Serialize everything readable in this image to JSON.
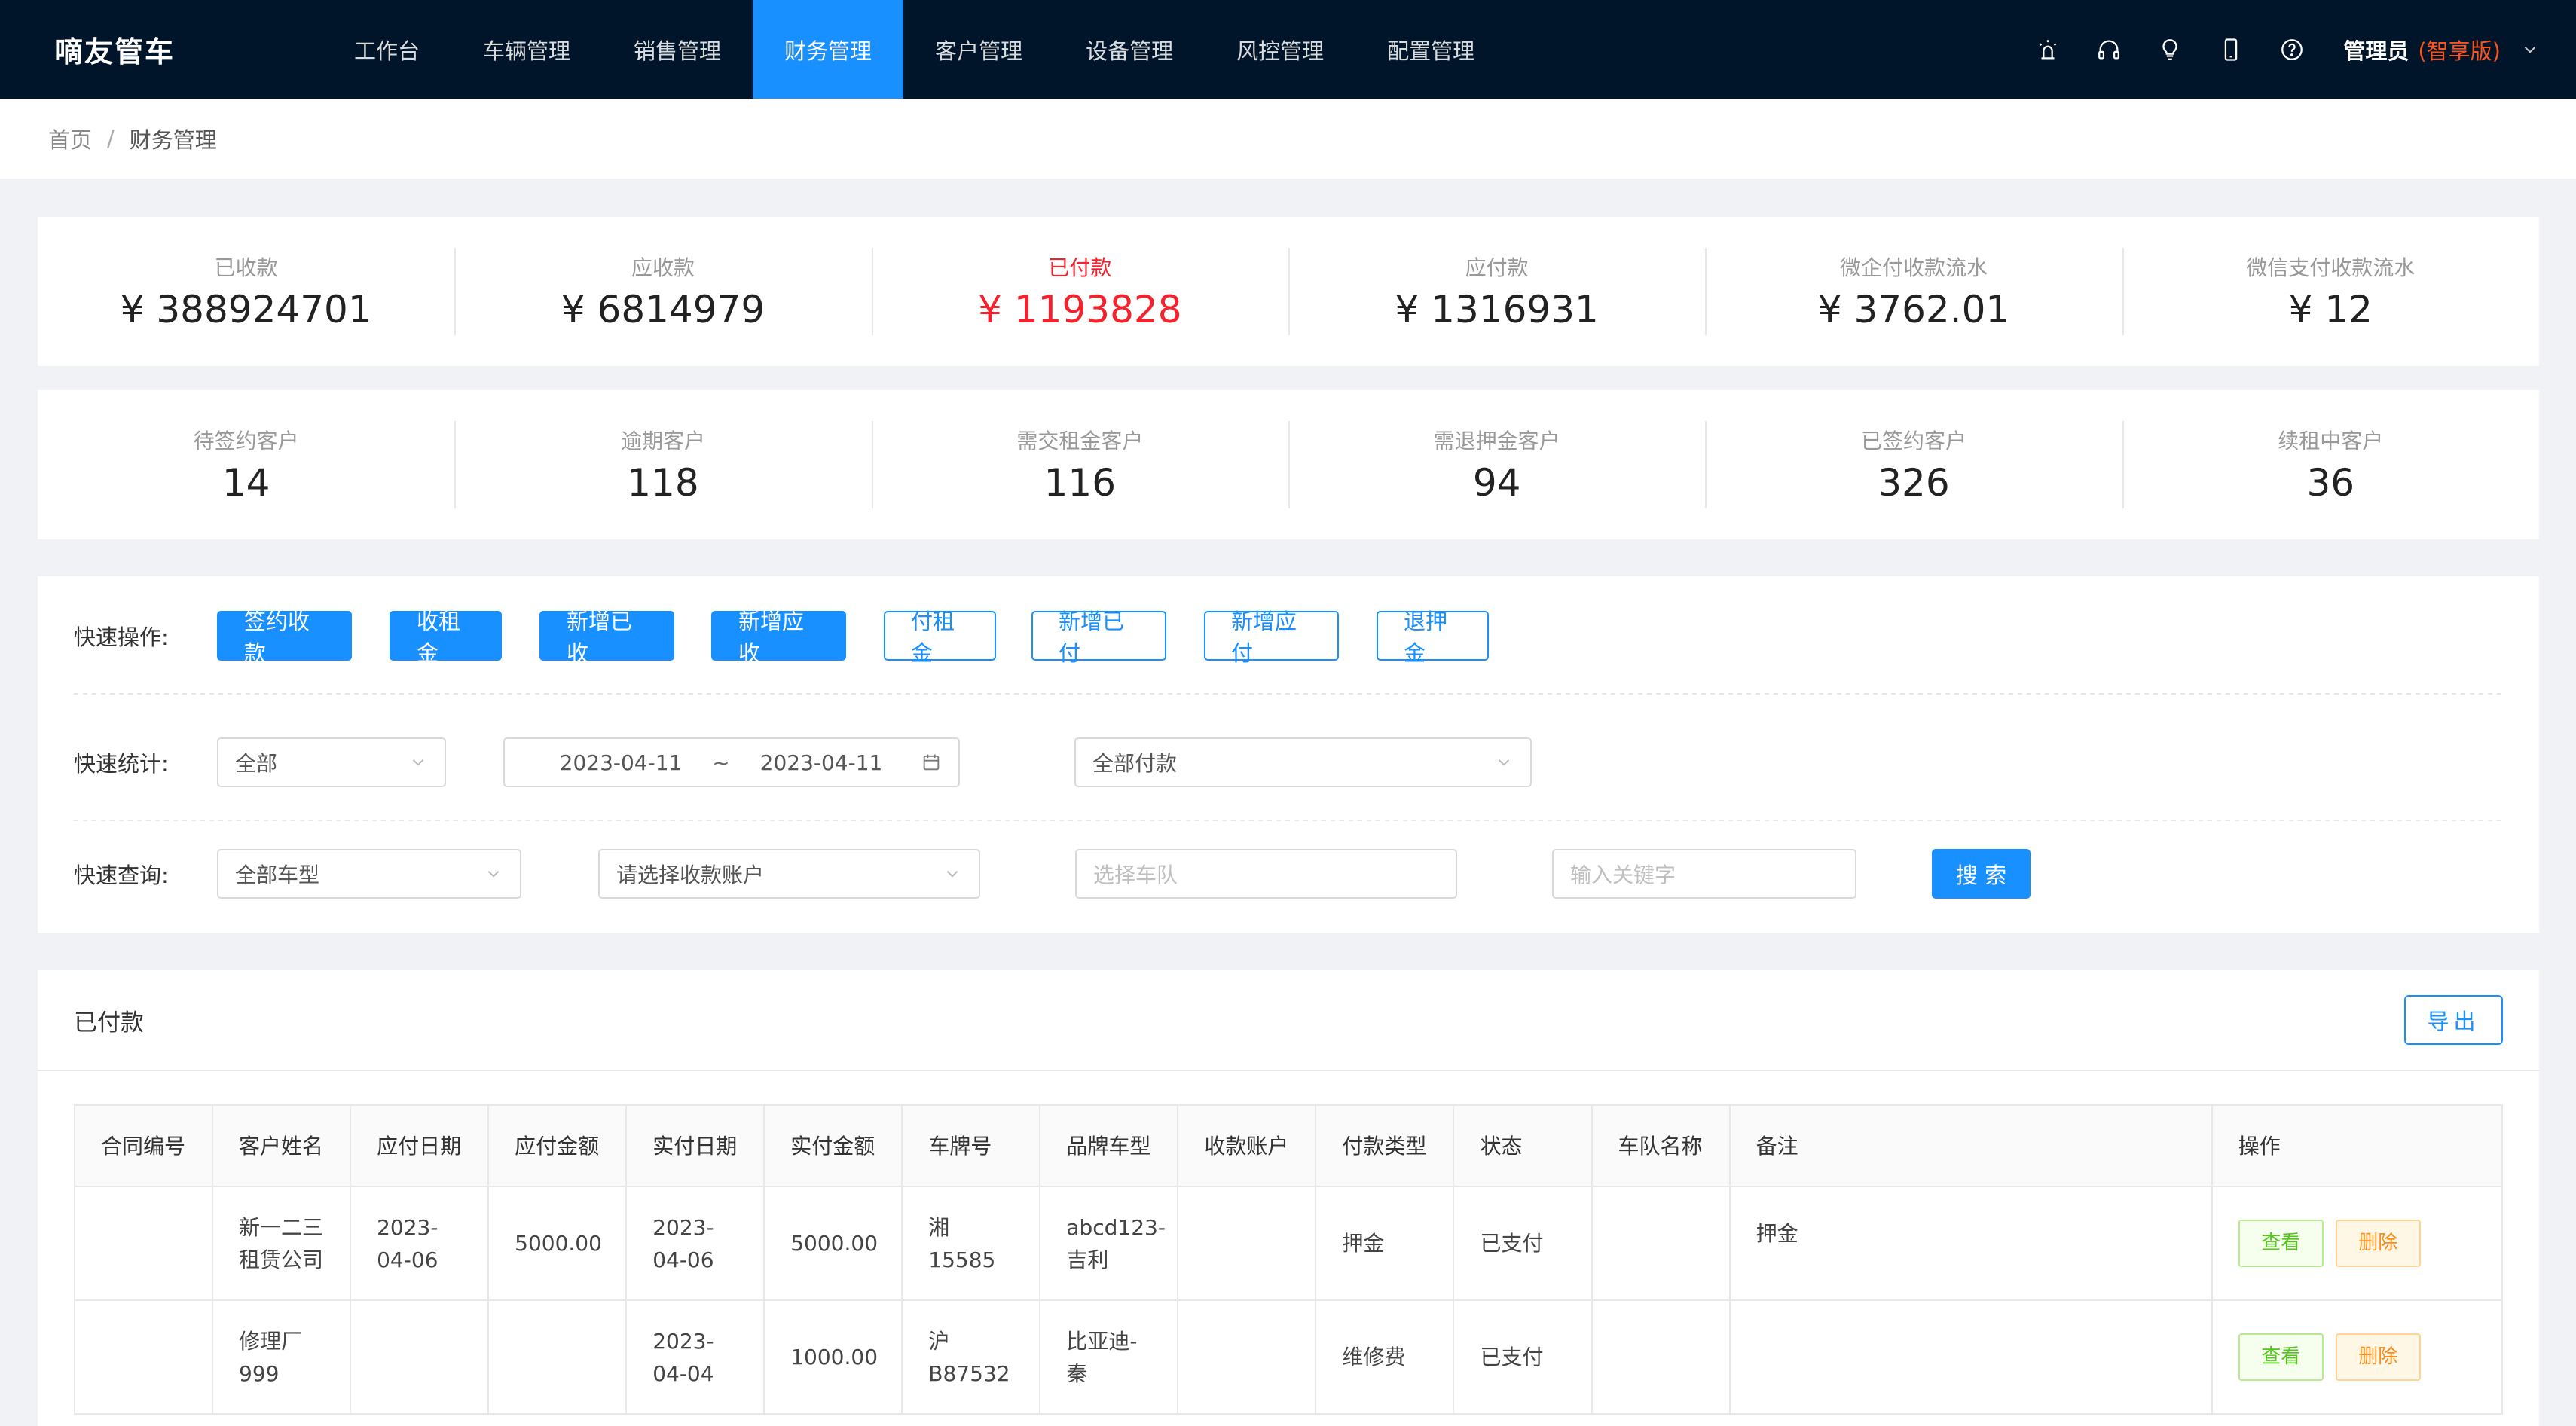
{
  "app": {
    "brand": "嘀友管车"
  },
  "menu": [
    {
      "label": "工作台",
      "active": false
    },
    {
      "label": "车辆管理",
      "active": false
    },
    {
      "label": "销售管理",
      "active": false
    },
    {
      "label": "财务管理",
      "active": true
    },
    {
      "label": "客户管理",
      "active": false
    },
    {
      "label": "设备管理",
      "active": false
    },
    {
      "label": "风控管理",
      "active": false
    },
    {
      "label": "配置管理",
      "active": false
    }
  ],
  "header_icons": [
    "alarm-icon",
    "headset-icon",
    "bulb-icon",
    "mobile-icon",
    "help-icon"
  ],
  "user": {
    "name": "管理员",
    "edition": "(智享版)"
  },
  "breadcrumb": {
    "home": "首页",
    "sep": "/",
    "current": "财务管理"
  },
  "summary": [
    {
      "label": "已收款",
      "value": "¥ 388924701"
    },
    {
      "label": "应收款",
      "value": "¥ 6814979"
    },
    {
      "label": "已付款",
      "value": "¥ 1193828",
      "highlight": true
    },
    {
      "label": "应付款",
      "value": "¥ 1316931"
    },
    {
      "label": "微企付收款流水",
      "value": "¥ 3762.01"
    },
    {
      "label": "微信支付收款流水",
      "value": "¥ 12"
    }
  ],
  "customers": [
    {
      "label": "待签约客户",
      "value": "14"
    },
    {
      "label": "逾期客户",
      "value": "118"
    },
    {
      "label": "需交租金客户",
      "value": "116"
    },
    {
      "label": "需退押金客户",
      "value": "94"
    },
    {
      "label": "已签约客户",
      "value": "326"
    },
    {
      "label": "续租中客户",
      "value": "36"
    }
  ],
  "quick_ops": {
    "label": "快速操作:",
    "buttons": [
      {
        "label": "签约收款",
        "style": "primary"
      },
      {
        "label": "收租金",
        "style": "primary"
      },
      {
        "label": "新增已收",
        "style": "primary"
      },
      {
        "label": "新增应收",
        "style": "primary"
      },
      {
        "label": "付租金",
        "style": "outline"
      },
      {
        "label": "新增已付",
        "style": "outline"
      },
      {
        "label": "新增应付",
        "style": "outline"
      },
      {
        "label": "退押金",
        "style": "outline"
      }
    ]
  },
  "quick_stats": {
    "label": "快速统计:",
    "scope": "全部",
    "date_start": "2023-04-11",
    "date_sep": "~",
    "date_end": "2023-04-11",
    "payment_filter": "全部付款"
  },
  "quick_query": {
    "label": "快速查询:",
    "car_type": "全部车型",
    "account_placeholder": "请选择收款账户",
    "fleet_placeholder": "选择车队",
    "keyword_placeholder": "输入关键字",
    "search_label": "搜 索"
  },
  "table": {
    "title": "已付款",
    "export_label": "导出",
    "columns": [
      "合同编号",
      "客户姓名",
      "应付日期",
      "应付金额",
      "实付日期",
      "实付金额",
      "车牌号",
      "品牌车型",
      "收款账户",
      "付款类型",
      "状态",
      "车队名称",
      "备注",
      "操作"
    ],
    "rows": [
      [
        "",
        "新一二三租赁公司",
        "2023-04-06",
        "5000.00",
        "2023-04-06",
        "5000.00",
        "湘15585",
        "abcd123-吉利",
        "",
        "押金",
        "已支付",
        "",
        "押金"
      ],
      [
        "",
        "修理厂999",
        "",
        "",
        "2023-04-04",
        "1000.00",
        "沪B87532",
        "比亚迪-秦",
        "",
        "维修费",
        "已支付",
        "",
        ""
      ]
    ],
    "view_label": "查看",
    "delete_label": "删除"
  }
}
